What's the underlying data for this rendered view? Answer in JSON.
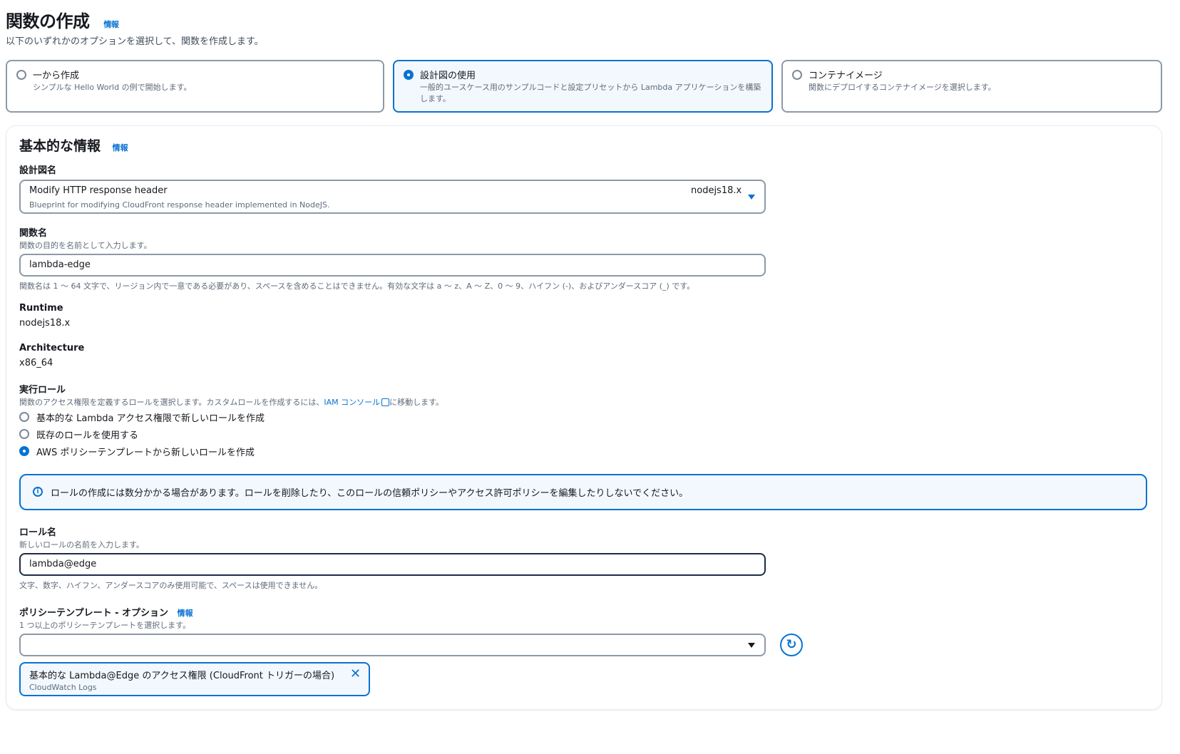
{
  "page": {
    "title": "関数の作成",
    "info": "情報",
    "description": "以下のいずれかのオプションを選択して、関数を作成します。"
  },
  "options": [
    {
      "title": "一から作成",
      "description": "シンプルな Hello World の例で開始します。",
      "selected": false
    },
    {
      "title": "設計図の使用",
      "description": "一般的ユースケース用のサンプルコードと設定プリセットから Lambda アプリケーションを構築します。",
      "selected": true
    },
    {
      "title": "コンテナイメージ",
      "description": "関数にデプロイするコンテナイメージを選択します。",
      "selected": false
    }
  ],
  "basic": {
    "title": "基本的な情報",
    "info": "情報",
    "blueprint": {
      "label": "設計図名",
      "name": "Modify HTTP response header",
      "description": "Blueprint for modifying CloudFront response header implemented in NodeJS.",
      "runtime": "nodejs18.x"
    },
    "function_name": {
      "label": "関数名",
      "description": "関数の目的を名前として入力します。",
      "value": "lambda-edge",
      "constraint": "関数名は 1 ～ 64 文字で、リージョン内で一意である必要があり、スペースを含めることはできません。有効な文字は a ～ z、A ～ Z、0 ～ 9、ハイフン (-)、およびアンダースコア (_) です。"
    },
    "runtime": {
      "label": "Runtime",
      "value": "nodejs18.x"
    },
    "architecture": {
      "label": "Architecture",
      "value": "x86_64"
    },
    "execution_role": {
      "label": "実行ロール",
      "description_before": "関数のアクセス権限を定義するロールを選択します。カスタムロールを作成するには、",
      "link": "IAM コンソール",
      "description_after": "に移動します。",
      "choices": [
        {
          "label": "基本的な Lambda アクセス権限で新しいロールを作成",
          "selected": false
        },
        {
          "label": "既存のロールを使用する",
          "selected": false
        },
        {
          "label": "AWS ポリシーテンプレートから新しいロールを作成",
          "selected": true
        }
      ]
    },
    "alert": "ロールの作成には数分かかる場合があります。ロールを削除したり、このロールの信頼ポリシーやアクセス許可ポリシーを編集したりしないでください。",
    "role_name": {
      "label": "ロール名",
      "description": "新しいロールの名前を入力します。",
      "value": "lambda@edge",
      "constraint": "文字、数字、ハイフン、アンダースコアのみ使用可能で、スペースは使用できません。"
    },
    "policy_templates": {
      "label": "ポリシーテンプレート - オプション",
      "info": "情報",
      "description": "1 つ以上のポリシーテンプレートを選択します。",
      "selected_value": "",
      "token": {
        "title": "基本的な Lambda@Edge のアクセス権限 (CloudFront トリガーの場合)",
        "subtitle": "CloudWatch Logs"
      }
    }
  },
  "colors": {
    "accent": "#0972d3",
    "text": "#16191f",
    "muted": "#5f6b7a",
    "border": "#8d99a8"
  },
  "icons": {
    "info": "info-circle-icon",
    "external": "external-link-icon",
    "refresh": "refresh-icon",
    "close": "close-icon",
    "dropdown": "caret-down-icon"
  }
}
